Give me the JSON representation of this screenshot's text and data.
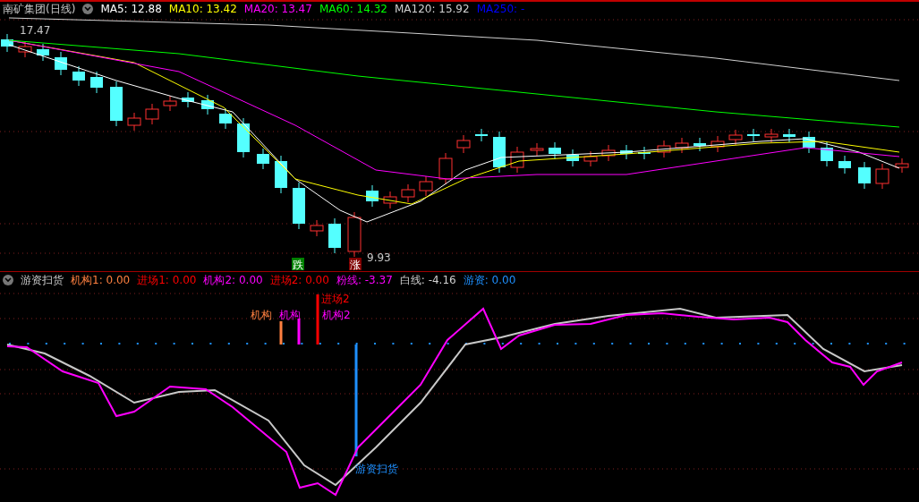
{
  "header": {
    "title": "南矿集团(日线)",
    "ma": [
      {
        "label": "MA5: 12.88",
        "color": "#ffffff"
      },
      {
        "label": "MA10: 13.42",
        "color": "#ffff00"
      },
      {
        "label": "MA20: 13.47",
        "color": "#ff00ff"
      },
      {
        "label": "MA60: 14.32",
        "color": "#00ff00"
      },
      {
        "label": "MA120: 15.92",
        "color": "#d0d0d0"
      },
      {
        "label": "MA250: -",
        "color": "#0000ff"
      }
    ]
  },
  "price_chart": {
    "high_label": "17.47",
    "low_label": "9.93",
    "signals": [
      {
        "text": "跌",
        "kind": "down"
      },
      {
        "text": "涨",
        "kind": "up"
      }
    ]
  },
  "indicator": {
    "title": "游资扫货",
    "readouts": [
      {
        "label": "机构1: 0.00",
        "color": "#ff8040"
      },
      {
        "label": "进场1: 0.00",
        "color": "#ff0000"
      },
      {
        "label": "机构2: 0.00",
        "color": "#ff00ff"
      },
      {
        "label": "进场2: 0.00",
        "color": "#ff0000"
      },
      {
        "label": "粉线: -3.37",
        "color": "#ff00ff"
      },
      {
        "label": "白线: -4.16",
        "color": "#d0d0d0"
      },
      {
        "label": "游资: 0.00",
        "color": "#1e90ff"
      }
    ],
    "bar_labels": [
      {
        "text": "进场2",
        "color": "#ff0000"
      },
      {
        "text": "机构",
        "color": "#ff8040"
      },
      {
        "text": "机构",
        "color": "#ff00ff"
      },
      {
        "text": "机构2",
        "color": "#ff00ff"
      }
    ],
    "signal_label": "游资扫货"
  }
}
